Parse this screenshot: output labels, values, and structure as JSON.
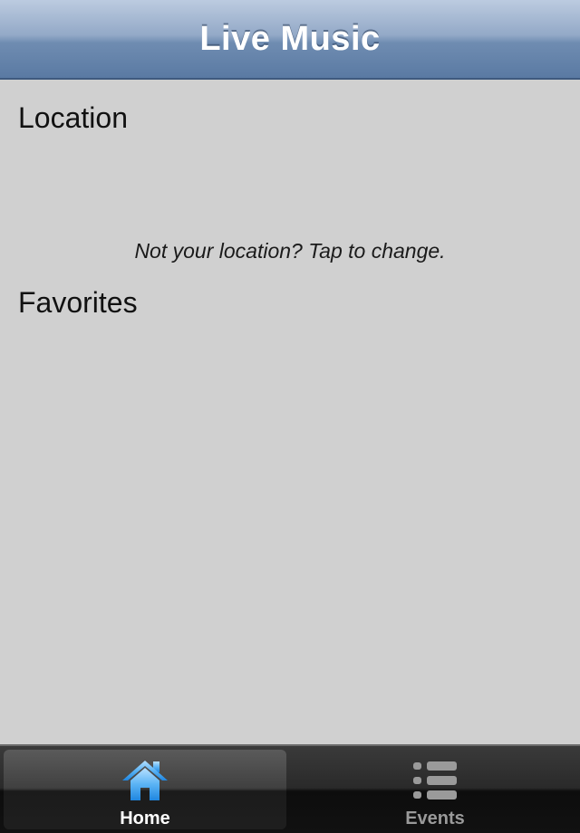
{
  "navbar": {
    "title": "Live Music"
  },
  "main": {
    "location_heading": "Location",
    "location_hint": "Not your location? Tap to change.",
    "favorites_heading": "Favorites"
  },
  "tabbar": {
    "tabs": [
      {
        "label": "Home",
        "icon": "home-icon",
        "selected": true
      },
      {
        "label": "Events",
        "icon": "list-icon",
        "selected": false
      }
    ]
  },
  "colors": {
    "navbar_accent": "#6f8cb1",
    "background": "#d0d0d0",
    "selected_icon": "#4aa6f0"
  }
}
